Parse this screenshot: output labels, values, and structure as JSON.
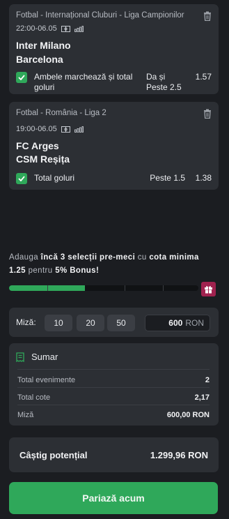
{
  "bets": [
    {
      "league": "Fotbal - Internațional Cluburi - Liga Campionilor",
      "datetime": "22:00-06.05",
      "home": "Inter Milano",
      "away": "Barcelona",
      "market": "Ambele marchează și total goluri",
      "selection": "Da și Peste 2.5",
      "odd": "1.57"
    },
    {
      "league": "Fotbal - România - Liga 2",
      "datetime": "19:00-06.05",
      "home": "FC Arges",
      "away": "CSM Reșița",
      "market": "Total goluri",
      "selection": "Peste 1.5",
      "odd": "1.38"
    }
  ],
  "promo": {
    "p1": "Adauga ",
    "b1": "încă 3 selecții pre-meci",
    "p2": " cu ",
    "b2": "cota minima 1.25",
    "p3": " pentru ",
    "b3": "5% Bonus!",
    "progress_fraction": 0.4
  },
  "stake": {
    "label": "Miză:",
    "quick": [
      "10",
      "20",
      "50"
    ],
    "value": "600",
    "currency": "RON"
  },
  "summary": {
    "title": "Sumar",
    "rows": [
      {
        "label": "Total evenimente",
        "value": "2"
      },
      {
        "label": "Total cote",
        "value": "2,17"
      },
      {
        "label": "Miză",
        "value": "600,00 RON"
      }
    ]
  },
  "winnings": {
    "label": "Câștig potențial",
    "value": "1.299,96 RON"
  },
  "place_bet_label": "Pariază acum",
  "colors": {
    "accent": "#2fa85a",
    "gift": "#a0224f",
    "card": "#2c2f34",
    "background": "#1b1d21"
  }
}
